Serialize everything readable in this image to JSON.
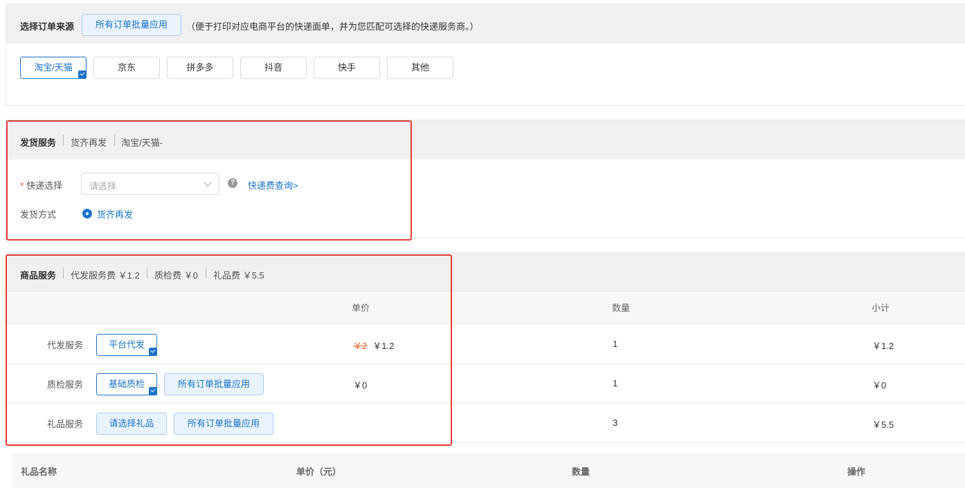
{
  "order_source": {
    "title": "选择订单来源",
    "batch_button": "所有订单批量应用",
    "hint": "（便于打印对应电商平台的快递面单，并为您匹配可选择的快递服务商。）",
    "platforms": [
      "淘宝/天猫",
      "京东",
      "拼多多",
      "抖音",
      "快手",
      "其他"
    ],
    "selected_platform": "淘宝/天猫"
  },
  "shipping": {
    "title": "发货服务",
    "crumbs": [
      "货齐再发",
      "淘宝/天猫-"
    ],
    "express_label": "快递选择",
    "required_mark": "*",
    "express_placeholder": "请选择",
    "help_icon": "?",
    "fee_link": "快递费查询>",
    "method_label": "发货方式",
    "method_option": "货齐再发"
  },
  "goods_service": {
    "title": "商品服务",
    "summary": [
      "代发服务费 ￥1.2",
      "质检费 ￥0",
      "礼品费 ￥5.5"
    ],
    "columns": [
      "单价",
      "数量",
      "小计"
    ],
    "rows": [
      {
        "label": "代发服务",
        "buttons": [
          "平台代发"
        ],
        "old_price": "￥2",
        "price": "￥1.2",
        "qty": "1",
        "subtotal": "￥1.2"
      },
      {
        "label": "质检服务",
        "buttons": [
          "基础质检",
          "所有订单批量应用"
        ],
        "price": "￥0",
        "qty": "1",
        "subtotal": "￥0"
      },
      {
        "label": "礼品服务",
        "buttons": [
          "请选择礼品",
          "所有订单批量应用"
        ],
        "qty": "3",
        "subtotal": "￥5.5"
      }
    ]
  },
  "gift_table": {
    "columns": [
      "礼品名称",
      "单价（元）",
      "数量",
      "操作"
    ]
  },
  "colors": {
    "accent": "#1a73c9",
    "annotation_red": "#e53935",
    "strike_price": "#e8602c",
    "header_bg": "#f0f0f0"
  }
}
